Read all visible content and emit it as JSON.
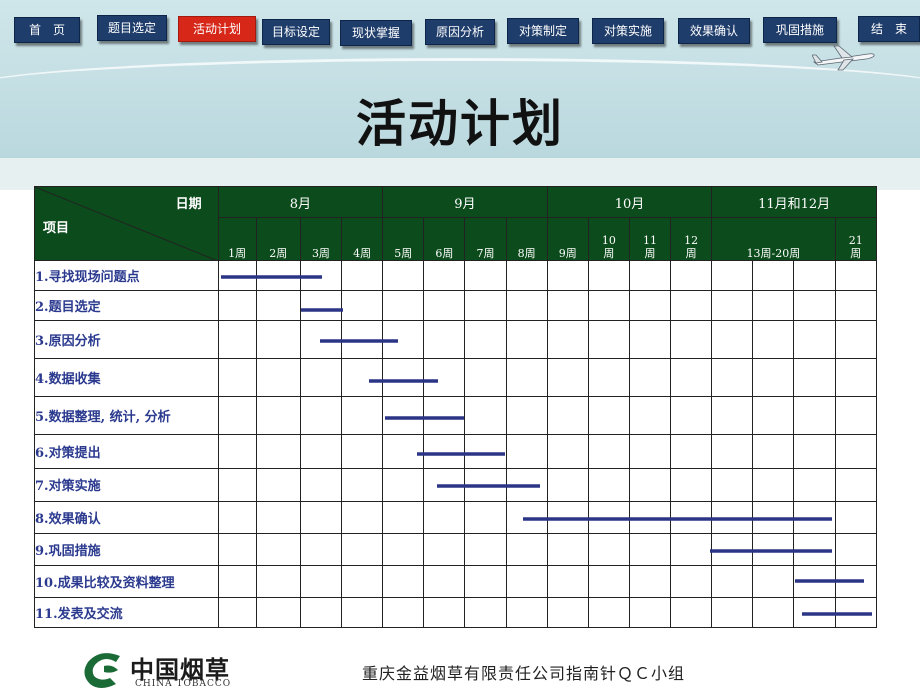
{
  "nav": [
    {
      "label": "首　页"
    },
    {
      "label": "题目选定"
    },
    {
      "label": "活动计划",
      "active": true
    },
    {
      "label": "目标设定"
    },
    {
      "label": "现状掌握"
    },
    {
      "label": "原因分析"
    },
    {
      "label": "对策制定"
    },
    {
      "label": "对策实施"
    },
    {
      "label": "效果确认"
    },
    {
      "label": "巩固措施"
    },
    {
      "label": "结　束"
    }
  ],
  "title": "活动计划",
  "table": {
    "corner_date": "日期",
    "corner_item": "项目",
    "months": [
      "8月",
      "9月",
      "10月",
      "11月和12月"
    ],
    "weeks": [
      "1周",
      "2周",
      "3周",
      "4周",
      "5周",
      "6周",
      "7周",
      "8周",
      "9周",
      "10\n周",
      "11\n周",
      "12\n周",
      "13周-20周",
      "21\n周"
    ],
    "tasks": [
      "1.寻找现场问题点",
      "2.题目选定",
      "3.原因分析",
      "4.数据收集",
      "5.数据整理, 统计, 分析",
      "6.对策提出",
      "7.对策实施",
      "8.效果确认",
      "9.巩固措施",
      "10.成果比较及资料整理",
      "11.发表及交流"
    ]
  },
  "colors": {
    "bar": "#2b3585",
    "header": "#0c4b1c",
    "nav": "#1f3d6b",
    "nav_active": "#d62718"
  },
  "footer": {
    "org": "重庆金益烟草有限责任公司指南针ＱＣ小组",
    "logo_cn": "中国烟草",
    "logo_en": "CHINA TOBACCO"
  }
}
